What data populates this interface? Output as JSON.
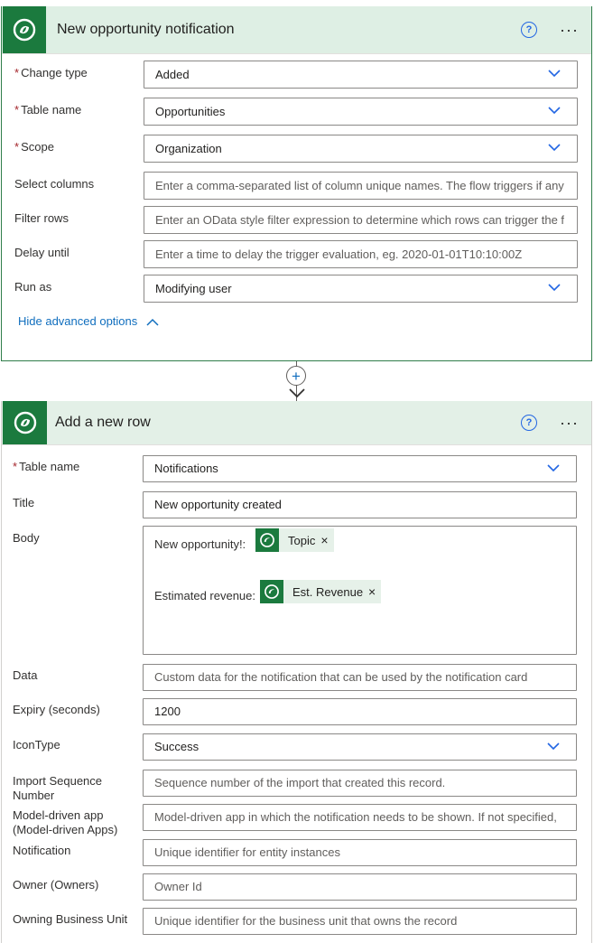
{
  "trigger": {
    "title": "New opportunity notification",
    "help": "?",
    "more": "···",
    "fields": [
      {
        "label": "Change type",
        "required": true,
        "value": "Added",
        "dropdown": true,
        "placeholder": false
      },
      {
        "label": "Table name",
        "required": true,
        "value": "Opportunities",
        "dropdown": true,
        "placeholder": false
      },
      {
        "label": "Scope",
        "required": true,
        "value": "Organization",
        "dropdown": true,
        "placeholder": false
      },
      {
        "label": "Select columns",
        "required": false,
        "value": "Enter a comma-separated list of column unique names. The flow triggers if any",
        "dropdown": false,
        "placeholder": true
      },
      {
        "label": "Filter rows",
        "required": false,
        "value": "Enter an OData style filter expression to determine which rows can trigger the f",
        "dropdown": false,
        "placeholder": true
      },
      {
        "label": "Delay until",
        "required": false,
        "value": "Enter a time to delay the trigger evaluation, eg. 2020-01-01T10:10:00Z",
        "dropdown": false,
        "placeholder": true
      },
      {
        "label": "Run as",
        "required": false,
        "value": "Modifying user",
        "dropdown": true,
        "placeholder": false
      }
    ],
    "advanced_label": "Hide advanced options"
  },
  "connector": {
    "plus": "+"
  },
  "action": {
    "title": "Add a new row",
    "help": "?",
    "more": "···",
    "table_name": {
      "label": "Table name",
      "value": "Notifications"
    },
    "title_field": {
      "label": "Title",
      "value": "New opportunity created"
    },
    "body": {
      "label": "Body",
      "line1_text": "New opportunity!:",
      "line1_token": "Topic",
      "line2_text": "Estimated revenue:",
      "line2_token": "Est. Revenue",
      "token_close": "×"
    },
    "data_field": {
      "label": "Data",
      "placeholder": "Custom data for the notification that can be used by the notification card"
    },
    "expiry": {
      "label": "Expiry (seconds)",
      "value": "1200"
    },
    "icon_type": {
      "label": "IconType",
      "value": "Success"
    },
    "import_seq": {
      "label_1": "Import Sequence",
      "label_2": "Number",
      "placeholder": "Sequence number of the import that created this record."
    },
    "model_app": {
      "label_1": "Model-driven app",
      "label_2": "(Model-driven Apps)",
      "placeholder": "Model-driven app in which the notification needs to be shown. If not specified,"
    },
    "notification": {
      "label": "Notification",
      "placeholder": "Unique identifier for entity instances"
    },
    "owner": {
      "label": "Owner (Owners)",
      "placeholder": "Owner Id"
    },
    "owning_bu": {
      "label": "Owning Business Unit",
      "placeholder": "Unique identifier for the business unit that owns the record"
    }
  },
  "colors": {
    "brand": "#1b7a3e",
    "header_bg": "#deefe4",
    "link": "#106ebe",
    "required": "#a4262c",
    "chevron": "#2266e3"
  }
}
